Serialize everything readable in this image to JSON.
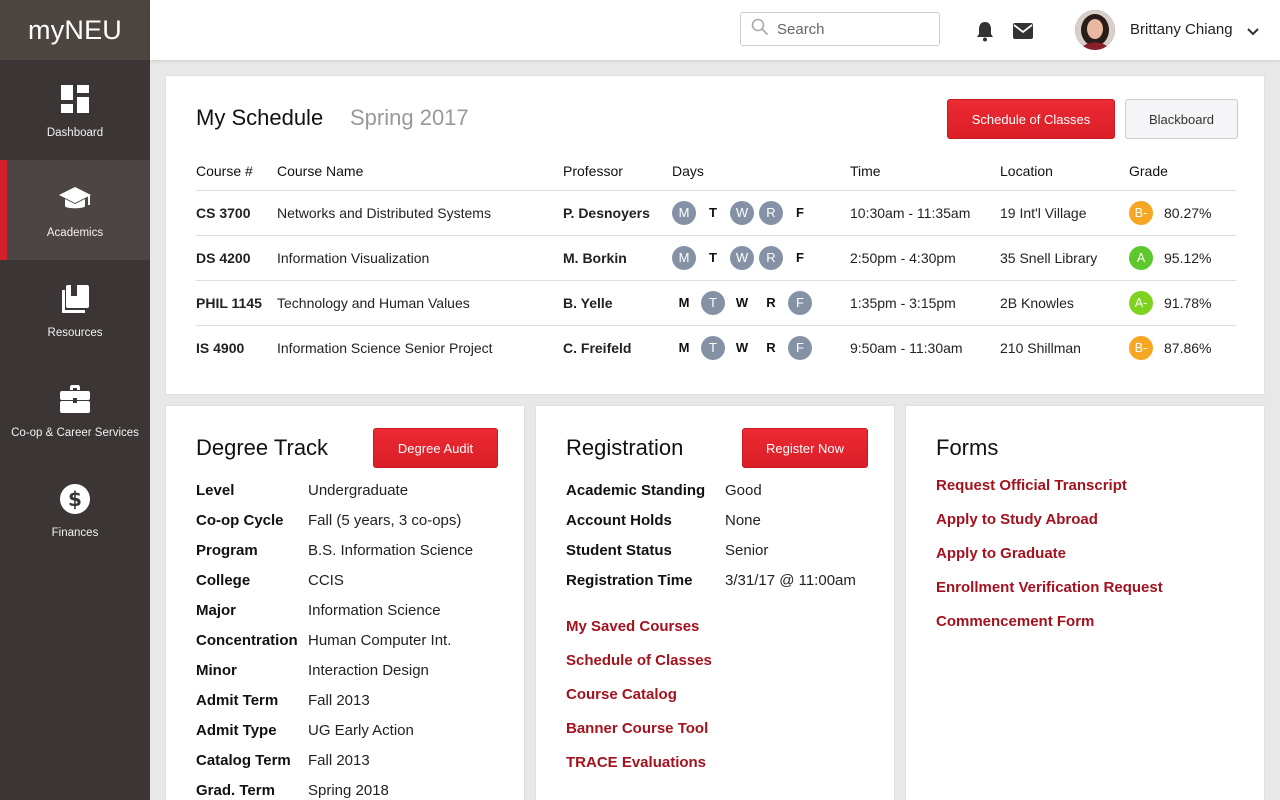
{
  "app": {
    "logo": "myNEU"
  },
  "sidebar": {
    "items": [
      {
        "label": "Dashboard",
        "icon": "dashboard-icon"
      },
      {
        "label": "Academics",
        "icon": "graduation-cap-icon",
        "active": true
      },
      {
        "label": "Resources",
        "icon": "books-icon"
      },
      {
        "label": "Co-op & Career Services",
        "icon": "briefcase-icon"
      },
      {
        "label": "Finances",
        "icon": "dollar-icon"
      }
    ]
  },
  "header": {
    "search_placeholder": "Search",
    "user_name": "Brittany Chiang"
  },
  "schedule": {
    "title": "My Schedule",
    "term": "Spring 2017",
    "btn_schedule": "Schedule of Classes",
    "btn_blackboard": "Blackboard",
    "columns": [
      "Course #",
      "Course Name",
      "Professor",
      "Days",
      "Time",
      "Location",
      "Grade"
    ],
    "rows": [
      {
        "course": "CS 3700",
        "name": "Networks and Distributed Systems",
        "professor": "P. Desnoyers",
        "days": [
          "M",
          "T",
          "W",
          "R",
          "F"
        ],
        "active": [
          "M",
          "W",
          "R"
        ],
        "time": "10:30am - 11:35am",
        "location": "19 Int'l Village",
        "letter": "B-",
        "percent": "80.27%",
        "grade_color": "#f5a623"
      },
      {
        "course": "DS 4200",
        "name": "Information Visualization",
        "professor": "M. Borkin",
        "days": [
          "M",
          "T",
          "W",
          "R",
          "F"
        ],
        "active": [
          "M",
          "W",
          "R"
        ],
        "time": "2:50pm - 4:30pm",
        "location": "35 Snell Library",
        "letter": "A",
        "percent": "95.12%",
        "grade_color": "#5cc82b"
      },
      {
        "course": "PHIL 1145",
        "name": "Technology and Human Values",
        "professor": "B. Yelle",
        "days": [
          "M",
          "T",
          "W",
          "R",
          "F"
        ],
        "active": [
          "T",
          "F"
        ],
        "time": "1:35pm - 3:15pm",
        "location": "2B Knowles",
        "letter": "A-",
        "percent": "91.78%",
        "grade_color": "#7ed321"
      },
      {
        "course": "IS 4900",
        "name": "Information Science Senior Project",
        "professor": "C. Freifeld",
        "days": [
          "M",
          "T",
          "W",
          "R",
          "F"
        ],
        "active": [
          "T",
          "F"
        ],
        "time": "9:50am - 11:30am",
        "location": "210 Shillman",
        "letter": "B-",
        "percent": "87.86%",
        "grade_color": "#f5a623"
      }
    ]
  },
  "degree": {
    "title": "Degree Track",
    "button": "Degree Audit",
    "rows": [
      {
        "k": "Level",
        "v": "Undergraduate"
      },
      {
        "k": "Co-op Cycle",
        "v": "Fall (5 years, 3 co-ops)"
      },
      {
        "k": "Program",
        "v": "B.S. Information Science"
      },
      {
        "k": "College",
        "v": "CCIS"
      },
      {
        "k": "Major",
        "v": "Information Science"
      },
      {
        "k": "Concentration",
        "v": "Human Computer Int."
      },
      {
        "k": "Minor",
        "v": "Interaction Design"
      },
      {
        "k": "Admit Term",
        "v": "Fall 2013"
      },
      {
        "k": "Admit Type",
        "v": "UG Early Action"
      },
      {
        "k": "Catalog Term",
        "v": "Fall 2013"
      },
      {
        "k": "Grad. Term",
        "v": "Spring 2018"
      }
    ]
  },
  "registration": {
    "title": "Registration",
    "button": "Register Now",
    "rows": [
      {
        "k": "Academic Standing",
        "v": "Good"
      },
      {
        "k": "Account Holds",
        "v": "None"
      },
      {
        "k": "Student Status",
        "v": "Senior"
      },
      {
        "k": "Registration Time",
        "v": "3/31/17 @ 11:00am"
      }
    ],
    "links": [
      "My Saved Courses",
      "Schedule of Classes",
      "Course Catalog",
      "Banner Course Tool",
      "TRACE Evaluations"
    ]
  },
  "forms": {
    "title": "Forms",
    "links": [
      "Request Official Transcript",
      "Apply to Study Abroad",
      "Apply to Graduate",
      "Enrollment Verification Request",
      "Commencement Form"
    ]
  },
  "colors": {
    "accent": "#e8262f",
    "link": "#a3121f",
    "sidebar": "#3b3535",
    "day_active": "#8592a6"
  }
}
